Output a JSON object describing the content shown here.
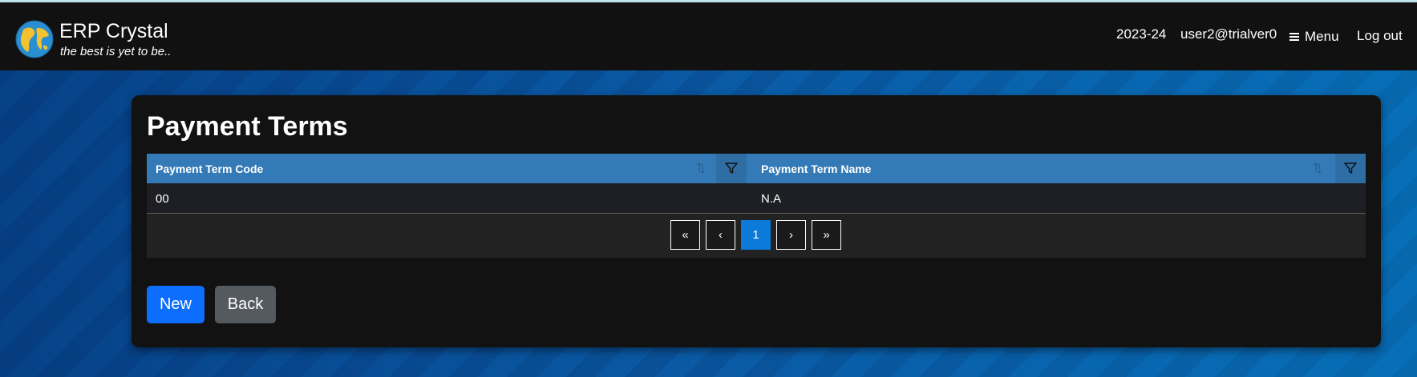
{
  "header": {
    "app_name": "ERP Crystal",
    "tagline": "the best is yet to be..",
    "financial_year": "2023-24",
    "user": "user2@trialver0",
    "menu_label": "Menu",
    "logout_label": "Log out"
  },
  "page": {
    "title": "Payment Terms"
  },
  "grid": {
    "columns": [
      {
        "label": "Payment Term Code"
      },
      {
        "label": "Payment Term Name"
      }
    ],
    "rows": [
      {
        "code": "00",
        "name": "N.A"
      }
    ]
  },
  "pager": {
    "first": "«",
    "prev": "‹",
    "current": "1",
    "next": "›",
    "last": "»"
  },
  "actions": {
    "new_label": "New",
    "back_label": "Back"
  },
  "colors": {
    "grid_header": "#337ab7",
    "primary_button": "#0d6efd",
    "secondary_button": "#555a61",
    "active_page": "#0c7ad8"
  },
  "icons": [
    "globe-logo-icon",
    "menu-icon",
    "sort-icon",
    "filter-icon"
  ]
}
